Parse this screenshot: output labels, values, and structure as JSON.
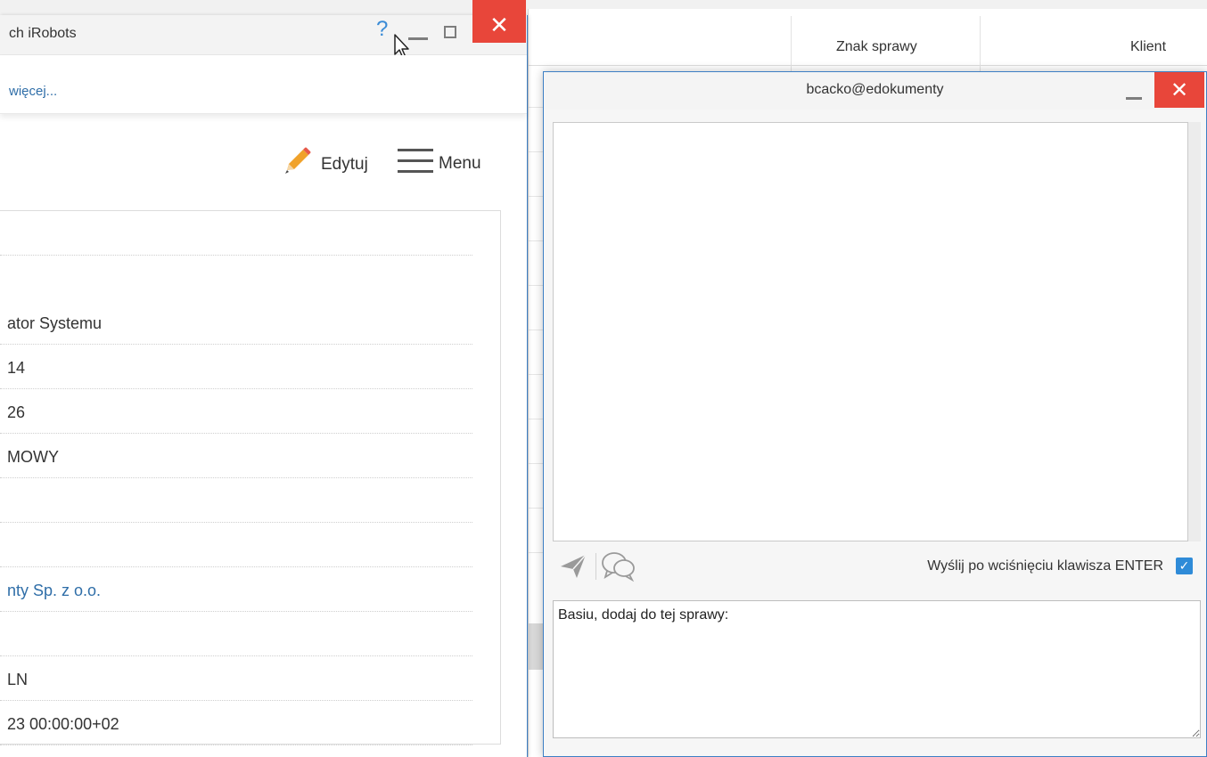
{
  "background_table": {
    "columns": [
      "Znak sprawy",
      "Klient"
    ]
  },
  "left_window": {
    "title": "ch iRobots",
    "titlebar_icons": [
      "help-icon",
      "minimize-icon",
      "maximize-icon",
      "close-icon"
    ],
    "more_link": "więcej...",
    "toolbar": {
      "edit_label": "Edytuj",
      "menu_label": "Menu"
    },
    "details": [
      "",
      "ator Systemu",
      "14",
      "26",
      "MOWY",
      "",
      "",
      "nty Sp. z o.o.",
      "",
      "LN",
      "23 00:00:00+02"
    ]
  },
  "chat_window": {
    "title": "bcacko@edokumenty",
    "send_on_enter_label": "Wyślij po wciśnięciu klawisza ENTER",
    "send_on_enter_checked": true,
    "input_value": "Basiu, dodaj do tej sprawy:",
    "icons": [
      "send-icon",
      "emoticon-icon",
      "minimize-icon",
      "close-icon"
    ]
  },
  "colors": {
    "close_red": "#e8463a",
    "accent_blue": "#3d7fc4",
    "link_blue": "#2f6ea8",
    "help_blue": "#3a8bd6"
  }
}
